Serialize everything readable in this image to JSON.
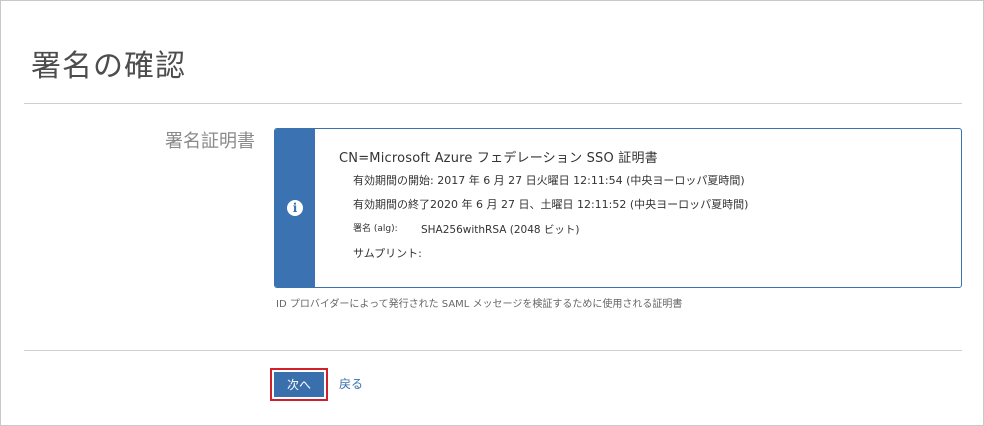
{
  "page": {
    "title": "署名の確認"
  },
  "signature": {
    "label": "署名証明書",
    "certificate": {
      "title": "CN=Microsoft Azure フェデレーション SSO 証明書",
      "valid_from": "有効期間の開始: 2017 年 6 月 27 日火曜日 12:11:54 (中央ヨーロッパ夏時間)",
      "valid_to": "有効期間の終了2020 年 6 月 27 日、土曜日 12:11:52 (中央ヨーロッパ夏時間)",
      "signature_label": "署名 (alg):",
      "signature_value": "SHA256withRSA (2048 ビット)",
      "thumbprint_label": "サムプリント:"
    },
    "helper_text": "ID プロバイダーによって発行された SAML メッセージを検証するために使用される証明書"
  },
  "actions": {
    "next_label": "次へ",
    "back_label": "戻る"
  },
  "icons": {
    "info": "info-icon"
  },
  "colors": {
    "accent": "#3b72b1",
    "highlight_border": "#d0202c"
  }
}
